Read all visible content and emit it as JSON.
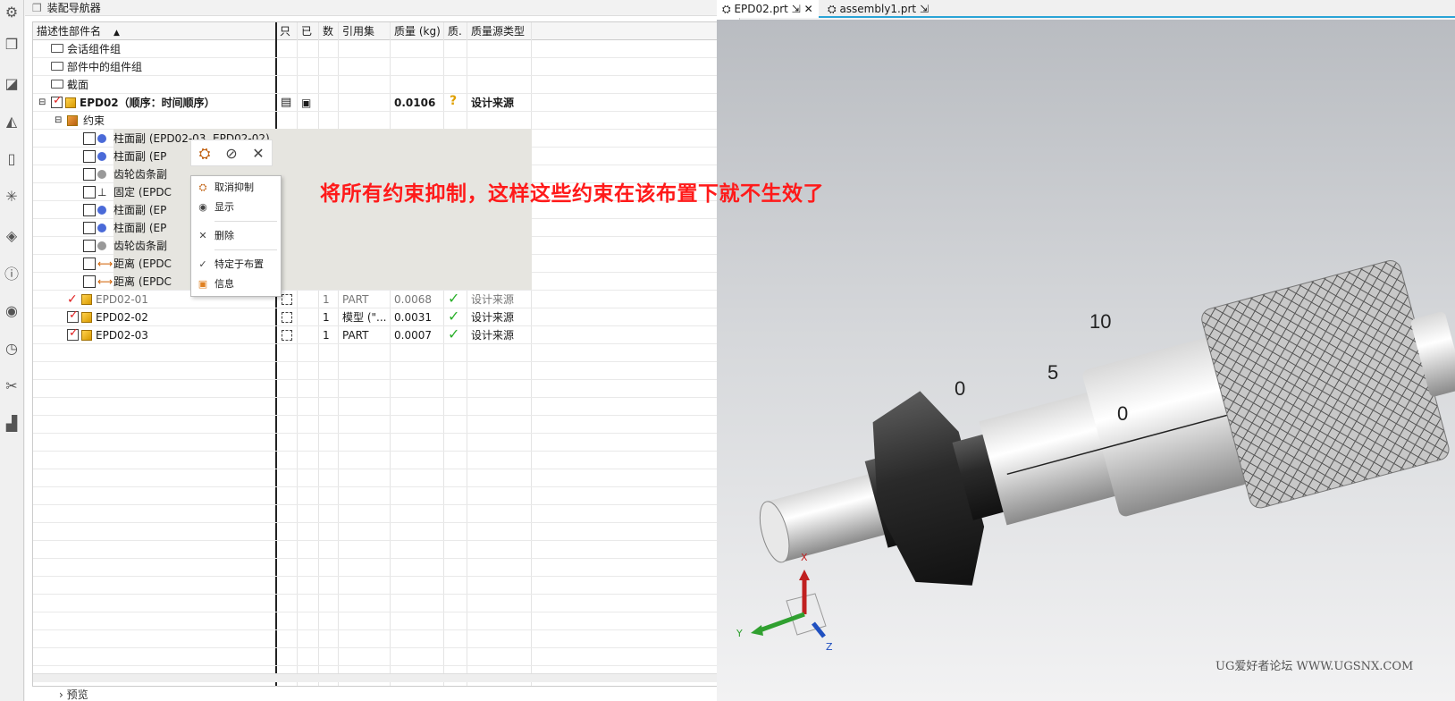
{
  "navigator": {
    "title": "装配导航器",
    "columns": [
      "描述性部件名",
      "只",
      "已",
      "数",
      "引用集",
      "质量 (kg)",
      "质.",
      "质量源类型"
    ],
    "rows": [
      {
        "label": "会话组件组"
      },
      {
        "label": "部件中的组件组"
      },
      {
        "label": "截面"
      },
      {
        "label": "EPD02（顺序：时间顺序）",
        "mass": "0.0106",
        "mass_src": "设计来源"
      },
      {
        "label": "约束"
      },
      {
        "label": "柱面副 (EPD02-03, EPD02-02)"
      },
      {
        "label": "柱面副 (EP"
      },
      {
        "label": "齿轮齿条副"
      },
      {
        "label": "固定 (EPDC"
      },
      {
        "label": "柱面副 (EP"
      },
      {
        "label": "柱面副 (EP"
      },
      {
        "label": "齿轮齿条副"
      },
      {
        "label": "距离 (EPDC"
      },
      {
        "label": "距离 (EPDC"
      },
      {
        "label": "EPD02-01",
        "count": "1",
        "refset": "PART",
        "mass": "0.0068",
        "mass_src": "设计来源"
      },
      {
        "label": "EPD02-02",
        "count": "1",
        "refset": "模型 (\"...",
        "mass": "0.0031",
        "mass_src": "设计来源"
      },
      {
        "label": "EPD02-03",
        "count": "1",
        "refset": "PART",
        "mass": "0.0007",
        "mass_src": "设计来源"
      }
    ],
    "context_menu": {
      "items": [
        "取消抑制",
        "显示",
        "删除",
        "特定于布置",
        "信息"
      ]
    },
    "preview_label": "预览"
  },
  "tabs": [
    {
      "label": "EPD02.prt"
    },
    {
      "label": "assembly1.prt"
    }
  ],
  "annotation": "将所有约束抑制，这样这些约束在该布置下就不生效了",
  "watermark": "UG爱好者论坛 WWW.UGSNX.COM",
  "axis_labels": {
    "x": "X",
    "y": "Y",
    "z": "Z"
  },
  "scale_numbers": {
    "n10": "10",
    "n5": "5",
    "n0a": "0",
    "n0b": "0"
  },
  "colors": {
    "accent": "#2aa4d6",
    "annotation": "#ff1a1a",
    "ok": "#2ab02a"
  }
}
